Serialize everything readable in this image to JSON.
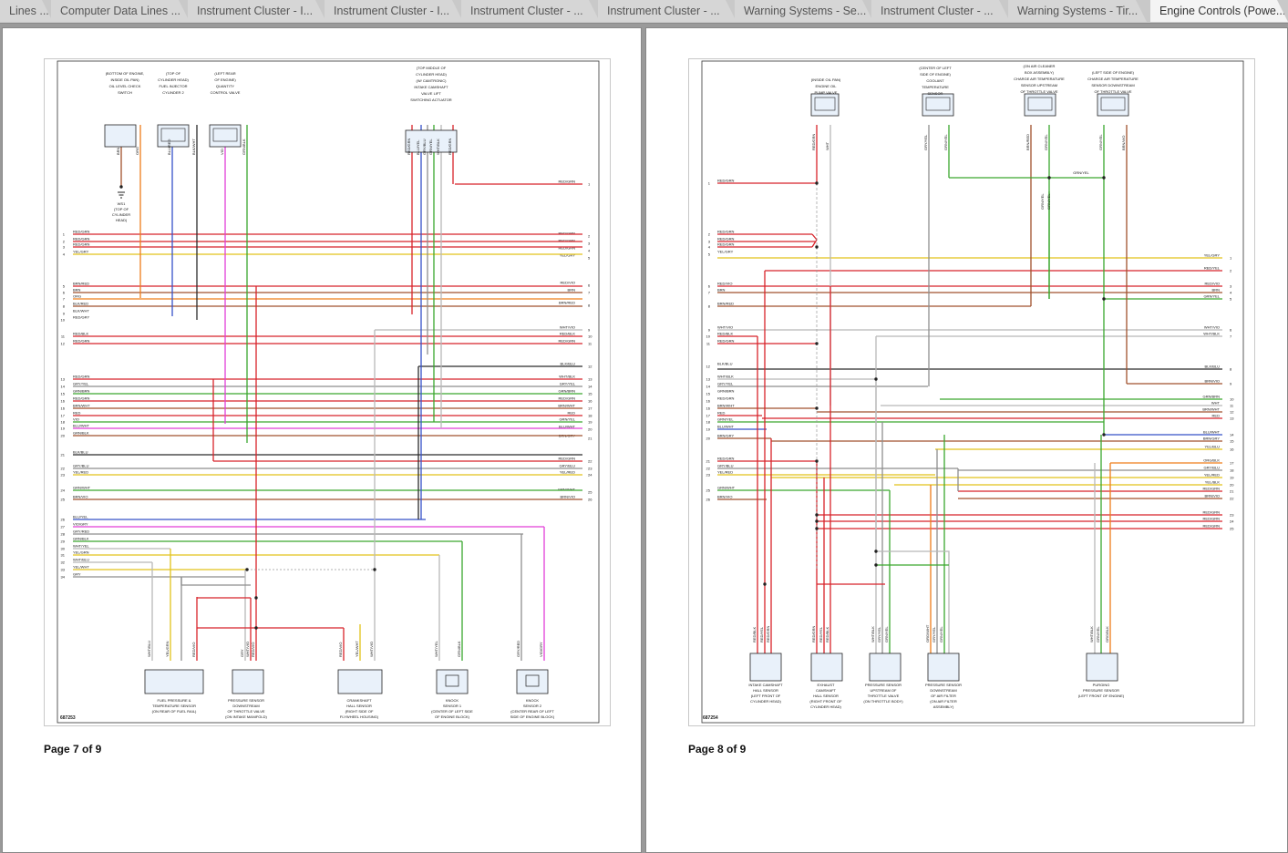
{
  "tabs": [
    {
      "label": "Lines ..."
    },
    {
      "label": "Computer Data Lines ..."
    },
    {
      "label": "Instrument Cluster - I..."
    },
    {
      "label": "Instrument Cluster - I..."
    },
    {
      "label": "Instrument Cluster - ..."
    },
    {
      "label": "Instrument Cluster - ..."
    },
    {
      "label": "Warning Systems - Se..."
    },
    {
      "label": "Instrument Cluster - ..."
    },
    {
      "label": "Warning Systems - Tir..."
    },
    {
      "label": "Engine Controls (Powe..."
    }
  ],
  "colors": {
    "window_bg": "#9a9a9a",
    "page_bg": "#ffffff",
    "tab_active": "#f4f4f4",
    "tab_inactive": "#d6d6d6"
  },
  "pages": [
    {
      "footer": "Page 7 of 9",
      "diagram_id": "687253",
      "components": [
        {
          "name": "oil-level-check-switch",
          "label": [
            "(BOTTOM OF ENGINE,",
            "INSIDE OIL PAN)",
            "OIL LEVEL CHECK",
            "SWITCH"
          ],
          "wires": [
            "BRN",
            "ORG"
          ]
        },
        {
          "name": "fuel-injector-cylinder-2",
          "label": [
            "(TOP OF",
            "CYLINDER HEAD)",
            "FUEL INJECTOR",
            "CYLINDER 2"
          ],
          "wires": [
            "BLU/RED",
            "BLK/WHT"
          ]
        },
        {
          "name": "quantity-control-valve",
          "label": [
            "(LEFT REAR",
            "OF ENGINE)",
            "QUANTITY",
            "CONTROL VALVE"
          ],
          "wires": [
            "VIO",
            "GRN/BLK"
          ]
        },
        {
          "name": "intake-camshaft-valve-lift-actuator",
          "label": [
            "(TOP MIDDLE OF",
            "CYLINDER HEAD)",
            "(W/ CAMTRONIC)",
            "INTAKE CAMSHAFT",
            "VALVE LIFT",
            "SWITCHING ACTUATOR"
          ],
          "wires": [
            "RED/GRN",
            "BLU/YEL",
            "GRY/BLU",
            "GRN/YEL",
            "WHT/BLK",
            "RED/GRN"
          ]
        },
        {
          "name": "ws1",
          "label": [
            "WS1",
            "(TOP OF",
            "CYLINDER",
            "HEAD)"
          ]
        },
        {
          "name": "fuel-pressure-temp-sensor",
          "label": [
            "FUEL PRESSURE &",
            "TEMPERATURE SENSOR",
            "(ON REAR OF FUEL RAIL)"
          ],
          "wires": [
            "WHT/BLU",
            "YEL/GRN",
            "RED/VIO"
          ]
        },
        {
          "name": "pressure-sensor-downstream-throttle",
          "label": [
            "PRESSURE SENSOR",
            "DOWNSTREAM",
            "OF THROTTLE VALVE",
            "(ON INTAKE MANIFOLD)"
          ],
          "wires": [
            "GRY",
            "WHT/VIO",
            "RED/VIO"
          ]
        },
        {
          "name": "crankshaft-hall-sensor",
          "label": [
            "CRANKSHAFT",
            "HALL SENSOR",
            "(RIGHT SIDE OF",
            "FLYWHEEL HOUSING)"
          ],
          "wires": [
            "RED/VIO",
            "YEL/WHT",
            "WHT/VIO"
          ]
        },
        {
          "name": "knock-sensor-1",
          "label": [
            "KNOCK",
            "SENSOR 1",
            "(CENTER OF LEFT SIDE",
            "OF ENGINE BLOCK)"
          ],
          "wires": [
            "WHT/YEL",
            "GRN/BLK"
          ]
        },
        {
          "name": "knock-sensor-2",
          "label": [
            "KNOCK",
            "SENSOR 2",
            "(CENTER REAR OF LEFT",
            "SIDE OF ENGINE BLOCK)"
          ],
          "wires": [
            "GRY/RED",
            "VIO/GRY"
          ]
        }
      ],
      "left_terminals": [
        {
          "num": "1",
          "wire": "RED/GRN"
        },
        {
          "num": "2",
          "wire": "RED/GRN"
        },
        {
          "num": "3",
          "wire": "RED/GRN"
        },
        {
          "num": "4",
          "wire": "YEL/GRY"
        },
        {
          "num": "5",
          "wire": "BRN/RED"
        },
        {
          "num": "6",
          "wire": "BRN"
        },
        {
          "num": "7",
          "wire": "ORG"
        },
        {
          "num": "8",
          "wire": "BLK/RED"
        },
        {
          "num": "9",
          "wire": "BLK/WHT"
        },
        {
          "num": "10",
          "wire": "RED/GRY"
        },
        {
          "num": "11",
          "wire": "RED/BLK"
        },
        {
          "num": "12",
          "wire": "RED/GRN"
        },
        {
          "num": "13",
          "wire": "RED/GRN"
        },
        {
          "num": "14",
          "wire": "GRY/YEL"
        },
        {
          "num": "15",
          "wire": "GRN/BRN"
        },
        {
          "num": "16",
          "wire": "RED/GRN"
        },
        {
          "num": "16",
          "wire": "BRN/WHT"
        },
        {
          "num": "17",
          "wire": "RED"
        },
        {
          "num": "18",
          "wire": "VIO"
        },
        {
          "num": "19",
          "wire": "BLU/WHT"
        },
        {
          "num": "20",
          "wire": "GRN/BLK"
        },
        {
          "num": "21",
          "wire": "BLK/BLU"
        },
        {
          "num": "22",
          "wire": "GRY/BLU"
        },
        {
          "num": "23",
          "wire": "YEL/RED"
        },
        {
          "num": "24",
          "wire": "GRN/WHT"
        },
        {
          "num": "25",
          "wire": "BRN/VIO"
        },
        {
          "num": "26",
          "wire": "BLU/YEL"
        },
        {
          "num": "27",
          "wire": "VIO/GRY"
        },
        {
          "num": "28",
          "wire": "GRY/RED"
        },
        {
          "num": "29",
          "wire": "GRN/BLK"
        },
        {
          "num": "30",
          "wire": "WHT/YEL"
        },
        {
          "num": "31",
          "wire": "YEL/GRN"
        },
        {
          "num": "32",
          "wire": "WHT/BLU"
        },
        {
          "num": "33",
          "wire": "YEL/WHT"
        },
        {
          "num": "34",
          "wire": "GRY"
        }
      ],
      "right_terminals": [
        {
          "num": "1",
          "wire": "RED/GRN"
        },
        {
          "num": "2",
          "wire": "RED/GRN"
        },
        {
          "num": "3",
          "wire": "RED/GRN"
        },
        {
          "num": "4",
          "wire": "RED/GRN"
        },
        {
          "num": "5",
          "wire": "YEL/GRY"
        },
        {
          "num": "6",
          "wire": "RED/VIO"
        },
        {
          "num": "7",
          "wire": "BRN"
        },
        {
          "num": "8",
          "wire": "BRN/RED"
        },
        {
          "num": "9",
          "wire": "WHT/VIO"
        },
        {
          "num": "10",
          "wire": "RED/BLK"
        },
        {
          "num": "11",
          "wire": "RED/GRN"
        },
        {
          "num": "12",
          "wire": "BLK/BLU"
        },
        {
          "num": "13",
          "wire": "WHT/BLK"
        },
        {
          "num": "14",
          "wire": "GRY/YEL"
        },
        {
          "num": "15",
          "wire": "GRN/BRN"
        },
        {
          "num": "16",
          "wire": "RED/GRN"
        },
        {
          "num": "17",
          "wire": "BRN/WHT"
        },
        {
          "num": "18",
          "wire": "RED"
        },
        {
          "num": "19",
          "wire": "GRN/YEL"
        },
        {
          "num": "20",
          "wire": "BLU/WHT"
        },
        {
          "num": "21",
          "wire": "BRN/GRY"
        },
        {
          "num": "22",
          "wire": "RED/GRN"
        },
        {
          "num": "23",
          "wire": "GRY/BLU"
        },
        {
          "num": "24",
          "wire": "YEL/RED"
        },
        {
          "num": "25",
          "wire": "GRN/WHT"
        },
        {
          "num": "26",
          "wire": "BRN/VIO"
        }
      ]
    },
    {
      "footer": "Page 8 of 9",
      "diagram_id": "687254",
      "components": [
        {
          "name": "engine-oil-pump-valve",
          "label": [
            "(INSIDE OIL PAN)",
            "ENGINE OIL",
            "PUMP VALVE"
          ],
          "wires": [
            "RED/GRN",
            "WHT"
          ]
        },
        {
          "name": "coolant-temperature-sensor",
          "label": [
            "(CENTER OF LEFT",
            "SIDE OF ENGINE)",
            "COOLANT",
            "TEMPERATURE",
            "SENSOR"
          ],
          "wires": [
            "GRY/YEL",
            "GRN/YEL"
          ]
        },
        {
          "name": "charge-air-temp-upstream",
          "label": [
            "(ON AIR CLEANER",
            "BOX ASSEMBLY)",
            "CHARGE AIR TEMPERATURE",
            "SENSOR UPSTREAM",
            "OF THROTTLE VALVE"
          ],
          "wires": [
            "BRN/RED",
            "GRN/YEL"
          ]
        },
        {
          "name": "charge-air-temp-downstream",
          "label": [
            "(LEFT SIDE OF ENGINE)",
            "CHARGE AIR TEMPERATURE",
            "SENSOR DOWNSTREAM",
            "OF THROTTLE VALVE"
          ],
          "wires": [
            "GRN/YEL",
            "BRN/VIO"
          ]
        },
        {
          "name": "intake-camshaft-hall-sensor",
          "label": [
            "INTAKE CAMSHAFT",
            "HALL SENSOR",
            "(LEFT FRONT OF",
            "CYLINDER HEAD)"
          ],
          "wires": [
            "RED/BLK",
            "RED/YEL",
            "RED/GRN"
          ]
        },
        {
          "name": "exhaust-camshaft-hall-sensor",
          "label": [
            "EXHAUST",
            "CAMSHAFT",
            "HALL SENSOR",
            "(RIGHT FRONT OF",
            "CYLINDER HEAD)"
          ],
          "wires": [
            "RED/GRN",
            "RED/YEL",
            "RED/BLK"
          ]
        },
        {
          "name": "pressure-sensor-upstream-throttle",
          "label": [
            "PRESSURE SENSOR",
            "UPSTREAM OF",
            "THROTTLE VALVE",
            "(ON THROTTLE BODY)"
          ],
          "wires": [
            "WHT/BLK",
            "GRY/YEL",
            "GRN/YEL"
          ]
        },
        {
          "name": "pressure-sensor-downstream-air-filter",
          "label": [
            "PRESSURE SENSOR",
            "DOWNSTREAM",
            "OF AIR FILTER",
            "(ON AIR FILTER",
            "ASSEMBLY)"
          ],
          "wires": [
            "ORG/WHT",
            "GRY/YEL",
            "GRN/YEL"
          ]
        },
        {
          "name": "purging-pressure-sensor",
          "label": [
            "PURGING",
            "PRESSURE SENSOR",
            "(LEFT FRONT OF ENGINE)"
          ],
          "wires": [
            "WHT/BLK",
            "GRN/YEL",
            "ORG/BLK"
          ]
        }
      ],
      "left_terminals": [
        {
          "num": "1",
          "wire": "RED/GRN"
        },
        {
          "num": "2",
          "wire": "RED/GRN"
        },
        {
          "num": "3",
          "wire": "RED/GRN"
        },
        {
          "num": "4",
          "wire": "RED/GRN"
        },
        {
          "num": "5",
          "wire": "YEL/GRY"
        },
        {
          "num": "6",
          "wire": "RED/VIO"
        },
        {
          "num": "7",
          "wire": "BRN"
        },
        {
          "num": "8",
          "wire": "BRN/RED"
        },
        {
          "num": "9",
          "wire": "WHT/VIO"
        },
        {
          "num": "10",
          "wire": "RED/BLK"
        },
        {
          "num": "11",
          "wire": "RED/GRN"
        },
        {
          "num": "12",
          "wire": "BLK/BLU"
        },
        {
          "num": "13",
          "wire": "WHT/BLK"
        },
        {
          "num": "14",
          "wire": "GRY/YEL"
        },
        {
          "num": "15",
          "wire": "GRN/BRN"
        },
        {
          "num": "16",
          "wire": "RED/GRN"
        },
        {
          "num": "16",
          "wire": "BRN/WHT"
        },
        {
          "num": "17",
          "wire": "RED"
        },
        {
          "num": "18",
          "wire": "GRN/YEL"
        },
        {
          "num": "19",
          "wire": "BLU/WHT"
        },
        {
          "num": "20",
          "wire": "BRN/GRY"
        },
        {
          "num": "21",
          "wire": "RED/GRN"
        },
        {
          "num": "22",
          "wire": "GRY/BLU"
        },
        {
          "num": "23",
          "wire": "YEL/RED"
        },
        {
          "num": "25",
          "wire": "GRN/WHT"
        },
        {
          "num": "26",
          "wire": "BRN/VIO"
        }
      ],
      "right_terminals": [
        {
          "num": "1",
          "wire": "YEL/GRY"
        },
        {
          "num": "2",
          "wire": "RED/YEL"
        },
        {
          "num": "3",
          "wire": "RED/VIO"
        },
        {
          "num": "4",
          "wire": "BRN"
        },
        {
          "num": "5",
          "wire": "GRN/YEL"
        },
        {
          "num": "6",
          "wire": "WHT/VIO"
        },
        {
          "num": "7",
          "wire": "WHT/BLK"
        },
        {
          "num": "8",
          "wire": "BLK/BLU"
        },
        {
          "num": "9",
          "wire": "BRN/VIO"
        },
        {
          "num": "10",
          "wire": "GRN/BRN"
        },
        {
          "num": "11",
          "wire": "WHT"
        },
        {
          "num": "12",
          "wire": "BRN/WHT"
        },
        {
          "num": "13",
          "wire": "RED"
        },
        {
          "num": "14",
          "wire": "BLU/WHT"
        },
        {
          "num": "15",
          "wire": "BRN/GRY"
        },
        {
          "num": "16",
          "wire": "YEL/BLU"
        },
        {
          "num": "17",
          "wire": "ORG/BLK"
        },
        {
          "num": "18",
          "wire": "GRY/BLU"
        },
        {
          "num": "19",
          "wire": "YEL/RED"
        },
        {
          "num": "20",
          "wire": "YEL/BLK"
        },
        {
          "num": "21",
          "wire": "RED/GRN"
        },
        {
          "num": "22",
          "wire": "BRN/VIO"
        },
        {
          "num": "23",
          "wire": "RED/GRN"
        },
        {
          "num": "24",
          "wire": "RED/GRN"
        },
        {
          "num": "25",
          "wire": "RED/GRN"
        }
      ]
    }
  ]
}
